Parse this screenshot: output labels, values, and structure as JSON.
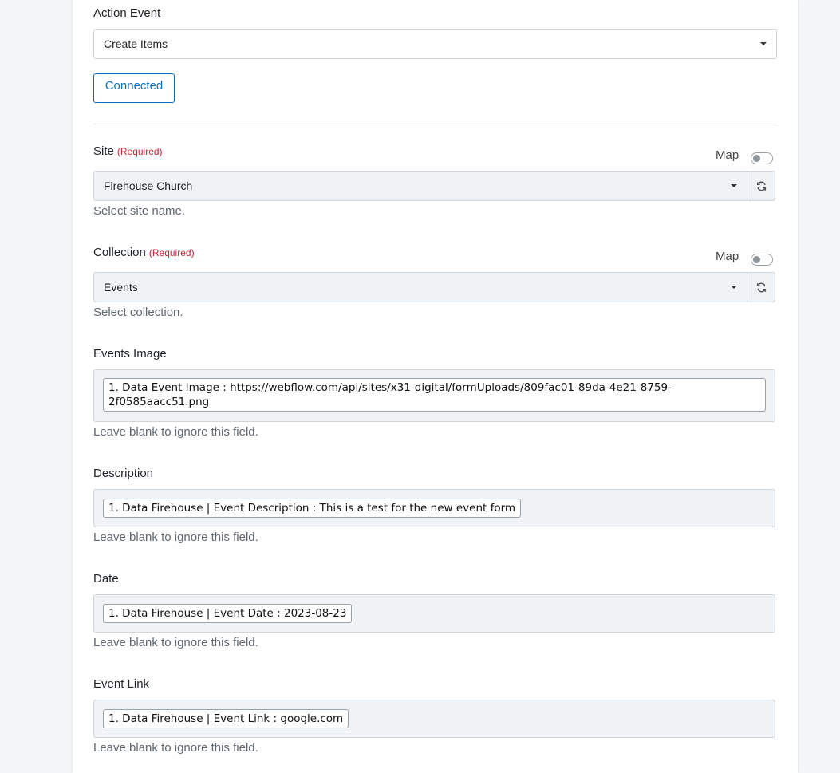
{
  "action_event": {
    "label": "Action Event",
    "value": "Create Items"
  },
  "connected_label": "Connected",
  "site": {
    "label": "Site",
    "required": "(Required)",
    "map_label": "Map",
    "value": "Firehouse Church",
    "help": "Select site name."
  },
  "collection": {
    "label": "Collection",
    "required": "(Required)",
    "map_label": "Map",
    "value": "Events",
    "help": "Select collection."
  },
  "fields": [
    {
      "label": "Events Image",
      "value": "1. Data Event Image : https://webflow.com/api/sites/x31-digital/formUploads/809fac01-89da-4e21-8759-2f0585aacc51.png",
      "help": "Leave blank to ignore this field."
    },
    {
      "label": "Description",
      "value": "1. Data Firehouse | Event Description : This is a test for the new event form",
      "help": "Leave blank to ignore this field."
    },
    {
      "label": "Date",
      "value": "1. Data Firehouse | Event Date : 2023-08-23",
      "help": "Leave blank to ignore this field."
    },
    {
      "label": "Event Link",
      "value": "1. Data Firehouse | Event Link : google.com",
      "help": "Leave blank to ignore this field."
    }
  ],
  "colors": {
    "accent": "#0a6fc2",
    "required": "#d0243c",
    "field_bg": "#f0f3f5"
  },
  "icons": {
    "dropdown": "caret-down-icon",
    "refresh": "refresh-icon"
  }
}
